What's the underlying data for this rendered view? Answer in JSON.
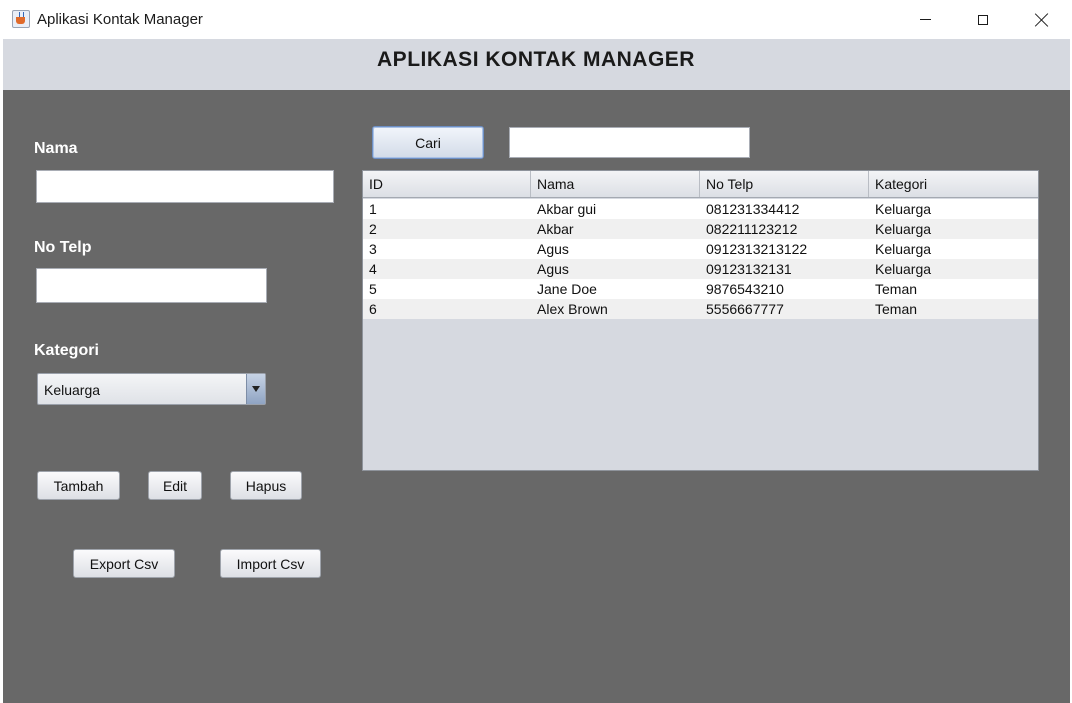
{
  "window": {
    "title": "Aplikasi Kontak Manager"
  },
  "header": {
    "title": "APLIKASI KONTAK MANAGER"
  },
  "form": {
    "nama_label": "Nama",
    "nama_value": "",
    "telp_label": "No Telp",
    "telp_value": "",
    "kategori_label": "Kategori",
    "kategori_value": "Keluarga"
  },
  "buttons": {
    "tambah": "Tambah",
    "edit": "Edit",
    "hapus": "Hapus",
    "export": "Export Csv",
    "import": "Import Csv",
    "cari": "Cari"
  },
  "search": {
    "value": ""
  },
  "table": {
    "columns": [
      "ID",
      "Nama",
      "No Telp",
      "Kategori"
    ],
    "rows": [
      [
        "1",
        "Akbar gui",
        "081231334412",
        "Keluarga"
      ],
      [
        "2",
        "Akbar",
        "082211123212",
        "Keluarga"
      ],
      [
        "3",
        "Agus",
        "0912313213122",
        "Keluarga"
      ],
      [
        "4",
        "Agus",
        "09123132131",
        "Keluarga"
      ],
      [
        "5",
        "Jane Doe",
        "9876543210",
        "Teman"
      ],
      [
        "6",
        "Alex Brown",
        "5556667777",
        "Teman"
      ]
    ]
  },
  "colors": {
    "main_bg": "#686868",
    "header_bg": "#d6d9e0",
    "table_bg": "#d6d9e0"
  }
}
